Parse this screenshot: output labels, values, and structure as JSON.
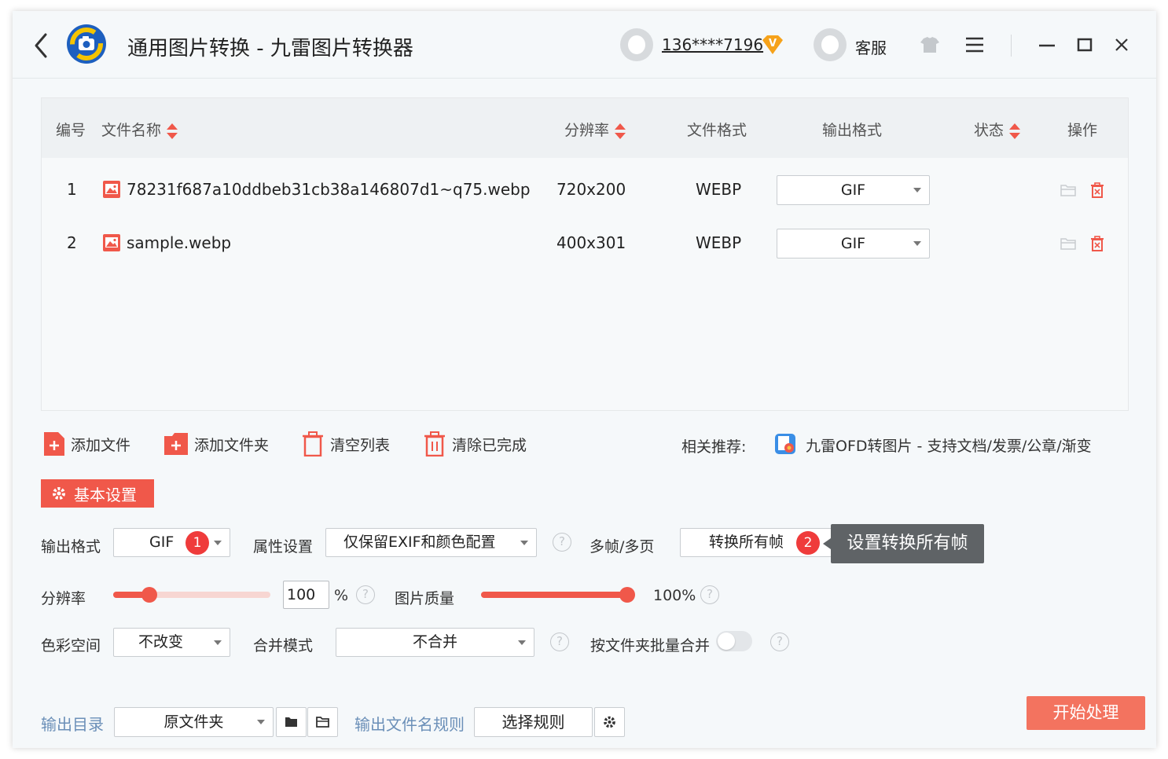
{
  "app": {
    "title": "通用图片转换 - 九雷图片转换器",
    "user_name": "136****7196",
    "vip_badge": "V",
    "service_label": "客服"
  },
  "table": {
    "headers": {
      "index": "编号",
      "name": "文件名称",
      "resolution": "分辨率",
      "format": "文件格式",
      "output": "输出格式",
      "status": "状态",
      "actions": "操作"
    },
    "rows": [
      {
        "index": "1",
        "name": "78231f687a10ddbeb31cb38a146807d1~q75.webp",
        "resolution": "720x200",
        "format": "WEBP",
        "output": "GIF",
        "status": ""
      },
      {
        "index": "2",
        "name": "sample.webp",
        "resolution": "400x301",
        "format": "WEBP",
        "output": "GIF",
        "status": ""
      }
    ]
  },
  "toolbar": {
    "add_file": "添加文件",
    "add_folder": "添加文件夹",
    "clear_list": "清空列表",
    "clear_done": "清除已完成",
    "recommend_label": "相关推荐:",
    "recommend_link": "九雷OFD转图片 - 支持文档/发票/公章/渐变"
  },
  "settings": {
    "tab_label": "基本设置",
    "output_format_label": "输出格式",
    "output_format_value": "GIF",
    "badge_1": "1",
    "attr_label": "属性设置",
    "attr_value": "仅保留EXIF和颜色配置",
    "multiframe_label": "多帧/多页",
    "multiframe_value": "转换所有帧",
    "badge_2": "2",
    "tooltip": "设置转换所有帧",
    "resolution_label": "分辨率",
    "resolution_value": "100",
    "resolution_percent": 0.23,
    "percent_sign": "%",
    "quality_label": "图片质量",
    "quality_value": "100%",
    "quality_percent": 1.0,
    "colorspace_label": "色彩空间",
    "colorspace_value": "不改变",
    "merge_label": "合并模式",
    "merge_value": "不合并",
    "batch_merge_label": "按文件夹批量合并",
    "batch_merge_on": false,
    "help_glyph": "?"
  },
  "footer": {
    "output_dir_label": "输出目录",
    "output_dir_value": "原文件夹",
    "filename_rule_label": "输出文件名规则",
    "filename_rule_button": "选择规则",
    "start_button": "开始处理"
  },
  "colors": {
    "accent": "#f0584a",
    "start": "#f3735f",
    "link_blue": "#6b8fb8",
    "badge_red": "#ef3b3b"
  }
}
